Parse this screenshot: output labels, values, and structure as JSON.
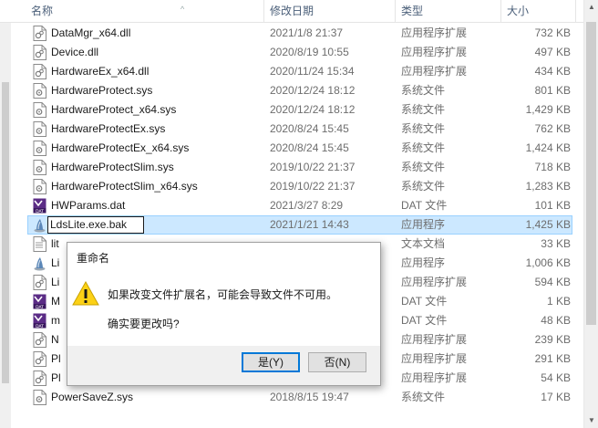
{
  "columns": {
    "name": "名称",
    "date": "修改日期",
    "type": "类型",
    "size": "大小"
  },
  "files": [
    {
      "name": "DataMgr_x64.dll",
      "date": "2021/1/8 21:37",
      "type": "应用程序扩展",
      "size": "732 KB",
      "icon": "dll-file-icon"
    },
    {
      "name": "Device.dll",
      "date": "2020/8/19 10:55",
      "type": "应用程序扩展",
      "size": "497 KB",
      "icon": "dll-file-icon"
    },
    {
      "name": "HardwareEx_x64.dll",
      "date": "2020/11/24 15:34",
      "type": "应用程序扩展",
      "size": "434 KB",
      "icon": "dll-file-icon"
    },
    {
      "name": "HardwareProtect.sys",
      "date": "2020/12/24 18:12",
      "type": "系统文件",
      "size": "801 KB",
      "icon": "sys-file-icon"
    },
    {
      "name": "HardwareProtect_x64.sys",
      "date": "2020/12/24 18:12",
      "type": "系统文件",
      "size": "1,429 KB",
      "icon": "sys-file-icon"
    },
    {
      "name": "HardwareProtectEx.sys",
      "date": "2020/8/24 15:45",
      "type": "系统文件",
      "size": "762 KB",
      "icon": "sys-file-icon"
    },
    {
      "name": "HardwareProtectEx_x64.sys",
      "date": "2020/8/24 15:45",
      "type": "系统文件",
      "size": "1,424 KB",
      "icon": "sys-file-icon"
    },
    {
      "name": "HardwareProtectSlim.sys",
      "date": "2019/10/22 21:37",
      "type": "系统文件",
      "size": "718 KB",
      "icon": "sys-file-icon"
    },
    {
      "name": "HardwareProtectSlim_x64.sys",
      "date": "2019/10/22 21:37",
      "type": "系统文件",
      "size": "1,283 KB",
      "icon": "sys-file-icon"
    },
    {
      "name": "HWParams.dat",
      "date": "2021/3/27 8:29",
      "type": "DAT 文件",
      "size": "101 KB",
      "icon": "dat-file-icon"
    },
    {
      "name": "LdsLite.exe.bak",
      "date": "2021/1/21 14:43",
      "type": "应用程序",
      "size": "1,425 KB",
      "icon": "exe-file-icon",
      "renaming": true
    },
    {
      "name": "lit",
      "date": "",
      "type": "文本文档",
      "size": "33 KB",
      "icon": "txt-file-icon"
    },
    {
      "name": "Li",
      "date": "",
      "type": "应用程序",
      "size": "1,006 KB",
      "icon": "exe-file-icon"
    },
    {
      "name": "Li",
      "date": "",
      "type": "应用程序扩展",
      "size": "594 KB",
      "icon": "dll-file-icon"
    },
    {
      "name": "M",
      "date": "",
      "type": "DAT 文件",
      "size": "1 KB",
      "icon": "dat-file-icon"
    },
    {
      "name": "m",
      "date": "",
      "type": "DAT 文件",
      "size": "48 KB",
      "icon": "dat-file-icon"
    },
    {
      "name": "N",
      "date": "",
      "type": "应用程序扩展",
      "size": "239 KB",
      "icon": "dll-file-icon"
    },
    {
      "name": "Pl",
      "date": "",
      "type": "应用程序扩展",
      "size": "291 KB",
      "icon": "dll-file-icon"
    },
    {
      "name": "Pl",
      "date": "",
      "type": "应用程序扩展",
      "size": "54 KB",
      "icon": "dll-file-icon"
    },
    {
      "name": "PowerSaveZ.sys",
      "date": "2018/8/15 19:47",
      "type": "系统文件",
      "size": "17 KB",
      "icon": "sys-file-icon"
    }
  ],
  "dialog": {
    "title": "重命名",
    "message": "如果改变文件扩展名，可能会导致文件不可用。",
    "question": "确实要更改吗?",
    "yes_label": "是(Y)",
    "no_label": "否(N)"
  },
  "colors": {
    "selection": "#cce8ff",
    "accent": "#0078d7",
    "warning": "#fcd116"
  }
}
